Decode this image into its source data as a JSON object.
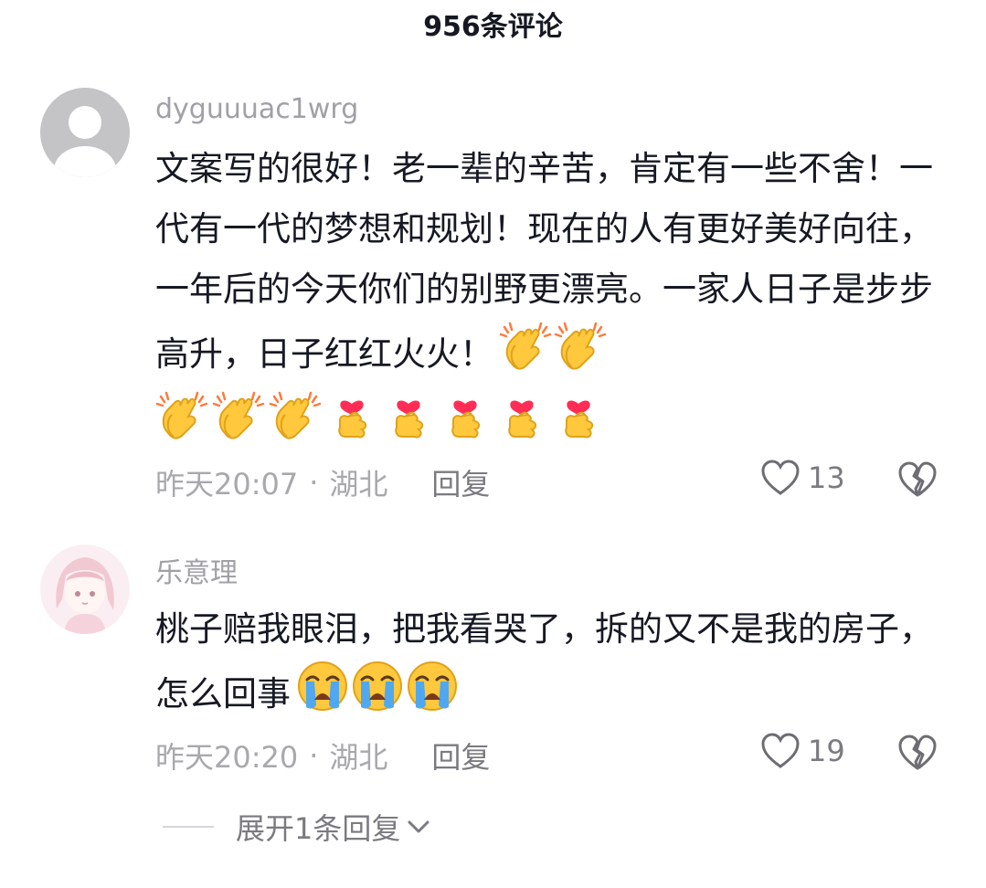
{
  "header": {
    "title": "956条评论"
  },
  "comments": [
    {
      "username": "dyguuuac1wrg",
      "text": "文案写的很好！老一辈的辛苦，肯定有一些不舍！一代有一代的梦想和规划！现在的人有更好美好向往，一年后的今天你们的别野更漂亮。一家人日子是步步高升，日子红红火火！",
      "emojis_inline": [
        "clapping-hands",
        "clapping-hands"
      ],
      "emojis_row": [
        "clapping-hands",
        "clapping-hands",
        "clapping-hands",
        "finger-heart",
        "finger-heart",
        "finger-heart",
        "finger-heart",
        "finger-heart"
      ],
      "time": "昨天20:07",
      "location": "湖北",
      "reply_label": "回复",
      "likes": "13"
    },
    {
      "username": "乐意理",
      "text": "桃子赔我眼泪，把我看哭了，拆的又不是我的房子，怎么回事",
      "emojis_inline": [
        "loudly-crying-face",
        "loudly-crying-face",
        "loudly-crying-face"
      ],
      "time": "昨天20:20",
      "location": "湖北",
      "reply_label": "回复",
      "likes": "19"
    }
  ],
  "expand_replies": {
    "label": "展开1条回复"
  },
  "colors": {
    "text": "#161823",
    "muted": "#a8a8ad",
    "emoji_yellow": "#ffc83d",
    "heart_red": "#ff2d55"
  }
}
